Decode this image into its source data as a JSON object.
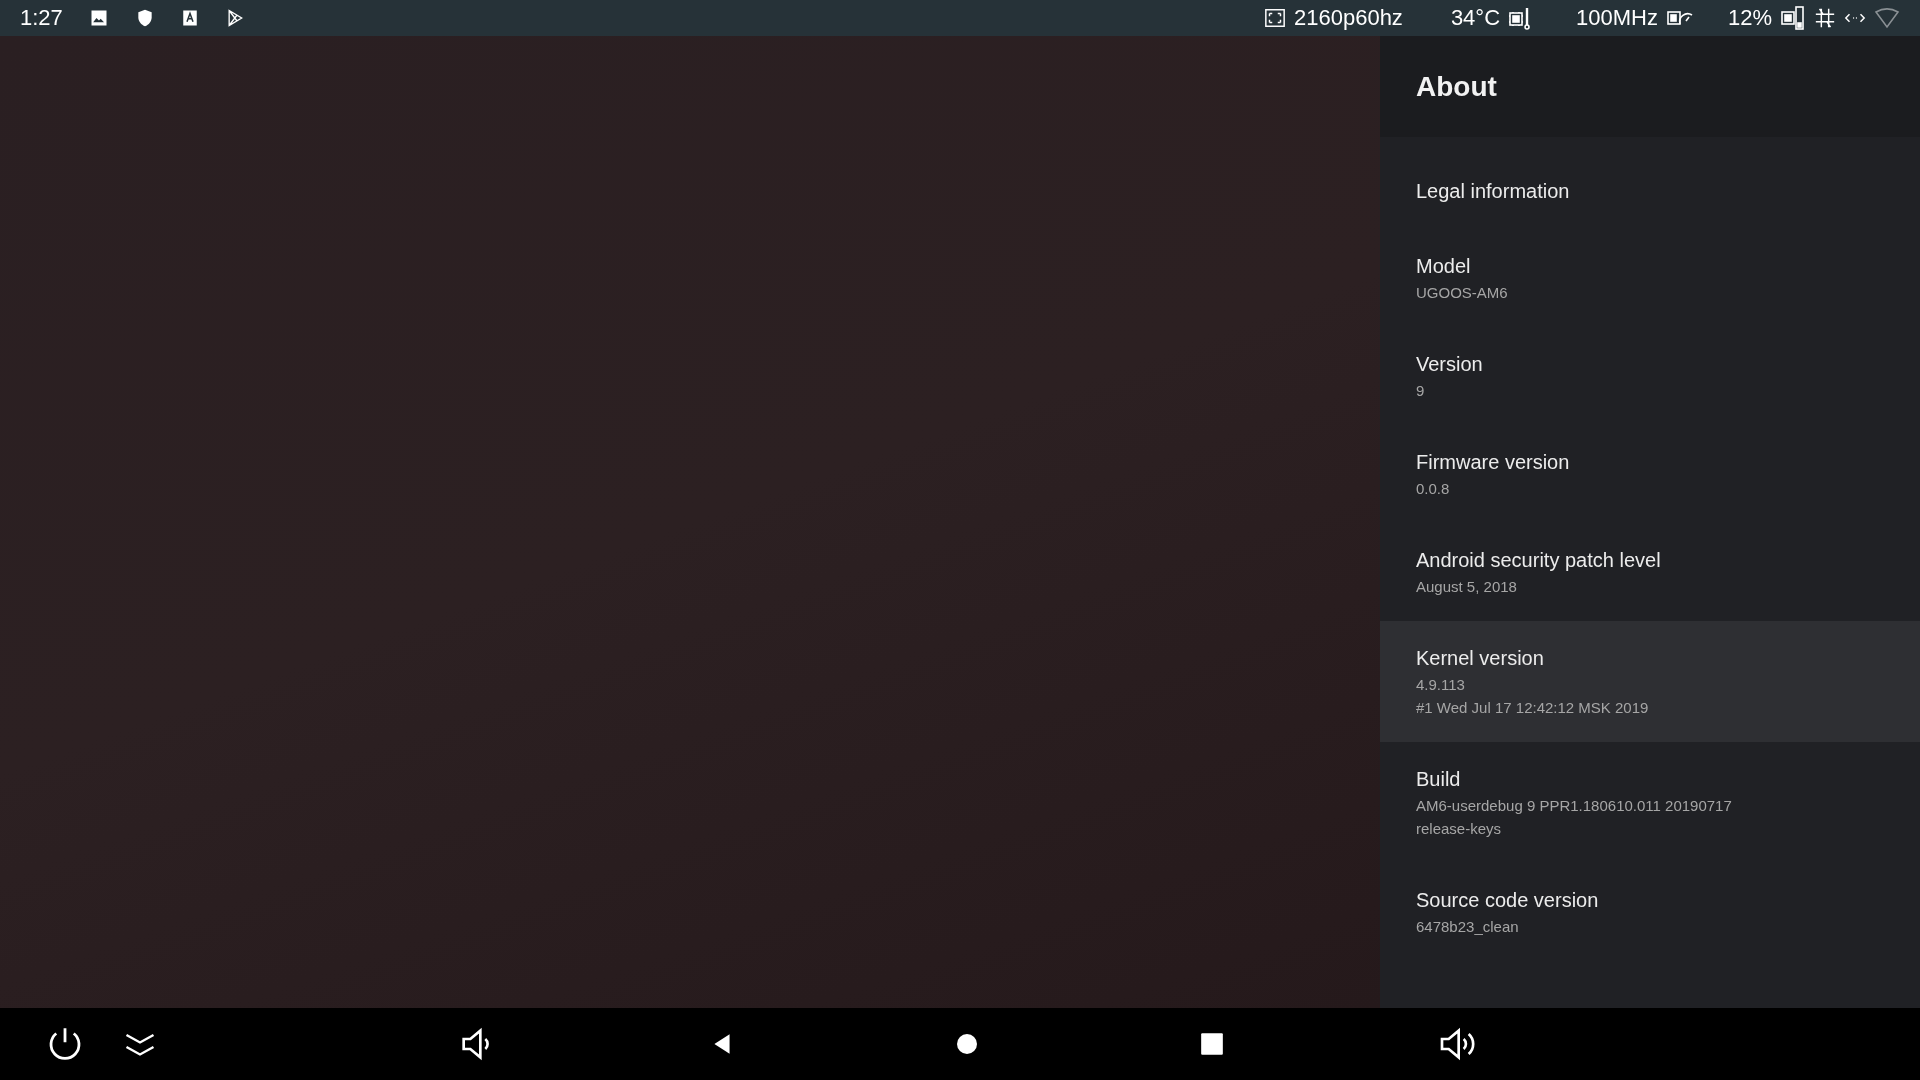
{
  "status_bar": {
    "time": "1:27",
    "resolution": "2160p60hz",
    "temperature": "34°C",
    "cpu_frequency": "100MHz",
    "cpu_load": "12%"
  },
  "panel": {
    "title": "About",
    "items": [
      {
        "title": "Legal information",
        "selected": false
      },
      {
        "title": "Model",
        "summary": [
          "UGOOS-AM6"
        ],
        "selected": false
      },
      {
        "title": "Version",
        "summary": [
          "9"
        ],
        "selected": false
      },
      {
        "title": "Firmware version",
        "summary": [
          "0.0.8"
        ],
        "selected": false
      },
      {
        "title": "Android security patch level",
        "summary": [
          "August 5, 2018"
        ],
        "selected": false
      },
      {
        "title": "Kernel version",
        "summary": [
          "4.9.113",
          "#1 Wed Jul 17 12:42:12 MSK 2019"
        ],
        "selected": true
      },
      {
        "title": "Build",
        "summary": [
          "AM6-userdebug 9 PPR1.180610.011 20190717",
          "release-keys"
        ],
        "selected": false
      },
      {
        "title": "Source code version",
        "summary": [
          "6478b23_clean"
        ],
        "selected": false
      }
    ]
  }
}
